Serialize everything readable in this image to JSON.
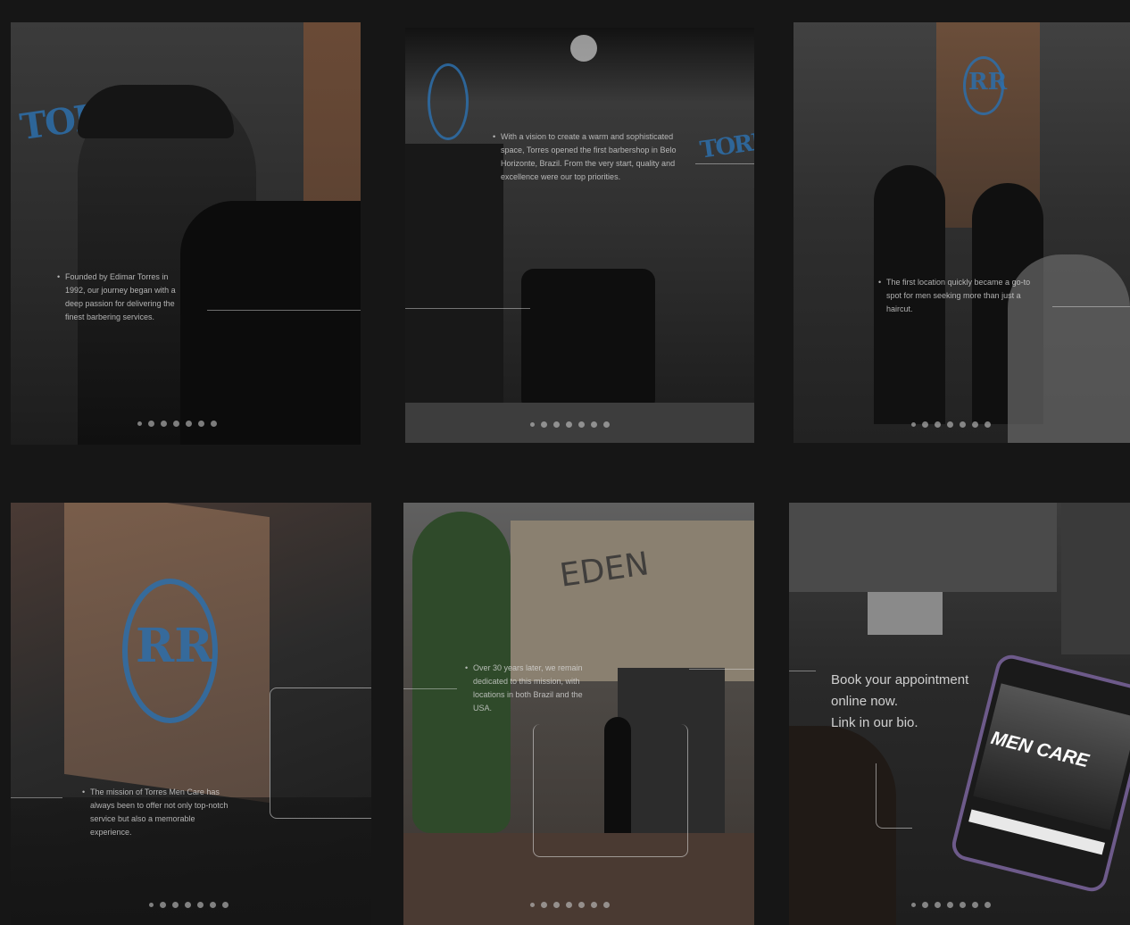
{
  "posts": [
    {
      "caption": "Founded by Edimar Torres in 1992, our journey began with a deep passion for delivering the finest barbering services.",
      "logo_text": "TORRES",
      "dots": 7
    },
    {
      "caption": "With a vision to create a warm and sophisticated space, Torres opened the first barbershop in Belo Horizonte, Brazil. From the very start, quality and excellence were our top priorities.",
      "logo_text": "TORRES",
      "dots": 7
    },
    {
      "caption": "The first location quickly became a go-to spot for men seeking more than just a haircut.",
      "logo_text": "RR",
      "dots": 7
    },
    {
      "caption": "The mission of Torres Men Care has always been to offer not only top-notch service but also a memorable experience.",
      "logo_text": "RR",
      "dots": 7
    },
    {
      "caption": "Over 30 years later, we remain dedicated to this mission, with locations in both Brazil and the USA.",
      "sign_text": "EDEN",
      "dots": 7
    },
    {
      "book_lines": [
        "Book your appointment",
        "online now.",
        "Link in our bio."
      ],
      "phone_text": "MEN CARE",
      "dots": 7
    }
  ],
  "bullet": "•"
}
